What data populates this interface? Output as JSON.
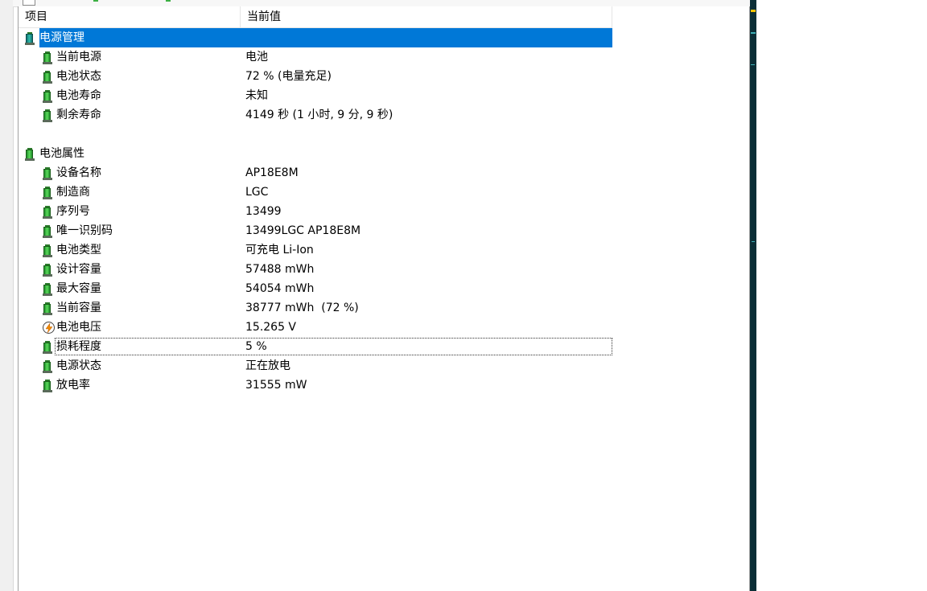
{
  "columns": {
    "item": "项目",
    "value": "当前值"
  },
  "sections": [
    {
      "title": "电源管理",
      "icon": "battery-teal-icon",
      "selected": true,
      "items": [
        {
          "label": "当前电源",
          "value": "电池",
          "icon": "battery-icon"
        },
        {
          "label": "电池状态",
          "value": "72 % (电量充足)",
          "icon": "battery-icon"
        },
        {
          "label": "电池寿命",
          "value": "未知",
          "icon": "battery-icon"
        },
        {
          "label": "剩余寿命",
          "value": "4149 秒 (1 小时, 9 分, 9 秒)",
          "icon": "battery-icon"
        }
      ]
    },
    {
      "title": "电池属性",
      "icon": "battery-icon",
      "selected": false,
      "items": [
        {
          "label": "设备名称",
          "value": "AP18E8M",
          "icon": "battery-icon"
        },
        {
          "label": "制造商",
          "value": "LGC",
          "icon": "battery-icon"
        },
        {
          "label": "序列号",
          "value": "13499",
          "icon": "battery-icon"
        },
        {
          "label": "唯一识别码",
          "value": "13499LGC AP18E8M",
          "icon": "battery-icon"
        },
        {
          "label": "电池类型",
          "value": "可充电 Li-Ion",
          "icon": "battery-icon"
        },
        {
          "label": "设计容量",
          "value": "57488 mWh",
          "icon": "battery-icon"
        },
        {
          "label": "最大容量",
          "value": "54054 mWh",
          "icon": "battery-icon"
        },
        {
          "label": "当前容量",
          "value": "38777 mWh  (72 %)",
          "icon": "battery-icon"
        },
        {
          "label": "电池电压",
          "value": "15.265 V",
          "icon": "voltage-icon"
        },
        {
          "label": "损耗程度",
          "value": "5 %",
          "icon": "battery-icon",
          "focused": true
        },
        {
          "label": "电源状态",
          "value": "正在放电",
          "icon": "battery-icon"
        },
        {
          "label": "放电率",
          "value": "31555 mW",
          "icon": "battery-icon"
        }
      ]
    }
  ],
  "colors": {
    "selection": "#0078d7",
    "battery_green": "#3cb043"
  }
}
